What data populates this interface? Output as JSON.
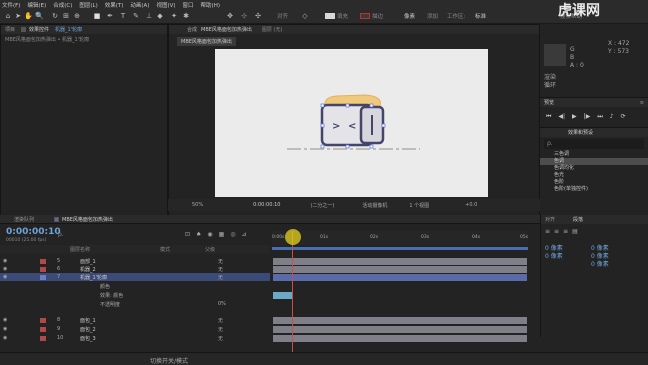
{
  "menu": [
    "文件(F)",
    "编辑(E)",
    "合成(C)",
    "图层(L)",
    "效果(T)",
    "动画(A)",
    "视图(V)",
    "窗口",
    "帮助(H)"
  ],
  "toolbar": {
    "align_label": "对齐",
    "fill_label": "填充",
    "stroke_label": "描边",
    "px_label": "像素",
    "add_label": "添加",
    "workspace_label": "工作区:",
    "workspace_value": "标准",
    "search_placeholder": "搜索帮助"
  },
  "watermark": {
    "text": "虎课网"
  },
  "left_panel": {
    "tab_project": "项目",
    "tab_effect": "效果控件",
    "effect_target": "机器_1'轮廓",
    "breadcrumb": "MBE风格面包加热弹出 • 机器_1'轮廓"
  },
  "comp_panel": {
    "tab_comp": "合成",
    "comp_name": "MBE风格面包加热弹出",
    "layer_tab": "图层 (无)",
    "comp_label": "MBE风格面包加热弹出"
  },
  "comp_footer": {
    "zoom": "50%",
    "time": "0:00:00:10",
    "resolution": "(二分之一)",
    "camera": "活动摄像机",
    "views": "1 个视图",
    "offset": "+0.0"
  },
  "info_panel": {
    "x_label": "X : 472",
    "y_label": "Y : 573",
    "readout_a": "G",
    "readout_b": "B",
    "readout_c": "A : 0",
    "line1": "渲染",
    "line2": "循环"
  },
  "preview_panel": {
    "title": "预览",
    "menu": "≡"
  },
  "effects_panel": {
    "title": "效果和预设",
    "items": [
      "三色调",
      "色调",
      "色调均化",
      "色光",
      "色阶",
      "色阶(单独控件)"
    ],
    "selected": 1,
    "search": "ρ."
  },
  "para_panel": {
    "tab1": "对齐",
    "tab2": "段落",
    "label_a": "0 像素",
    "label_b": "0 像素",
    "label_c": "0 像素",
    "label_d": "0 像素",
    "label_e": "0 像素"
  },
  "timeline": {
    "tab_render": "渲染队列",
    "tab_comp": "MBE风格面包加热弹出",
    "current_time": "0:00:00:10",
    "fps": "00010 (25.00 fps)",
    "col_source": "图层名称",
    "col_mode": "模式",
    "col_parent": "父级",
    "search": "ρ.",
    "ruler": [
      "0:00s",
      "01s",
      "02s",
      "03s",
      "04s",
      "05s"
    ],
    "footer": "切换开关/模式",
    "layers": [
      {
        "num": "5",
        "name": "面部_1",
        "parent": "无",
        "color": "#b04a4a"
      },
      {
        "num": "6",
        "name": "机器_2",
        "parent": "无",
        "color": "#b04a4a"
      },
      {
        "num": "7",
        "name": "机器_1'轮廓",
        "parent": "无",
        "color": "#6a7ec8"
      },
      {
        "num": "",
        "name": "颜色",
        "parent": "",
        "color": "#888"
      },
      {
        "num": "",
        "name": "效果: 颜色",
        "parent": "",
        "color": "#888"
      },
      {
        "num": "",
        "name": "不透明度",
        "parent": "0%",
        "color": "#888"
      },
      {
        "num": "8",
        "name": "面包_1",
        "parent": "无",
        "color": "#b04a4a"
      },
      {
        "num": "9",
        "name": "面包_2",
        "parent": "无",
        "color": "#b04a4a"
      },
      {
        "num": "10",
        "name": "面包_3",
        "parent": "无",
        "color": "#b04a4a"
      }
    ]
  }
}
